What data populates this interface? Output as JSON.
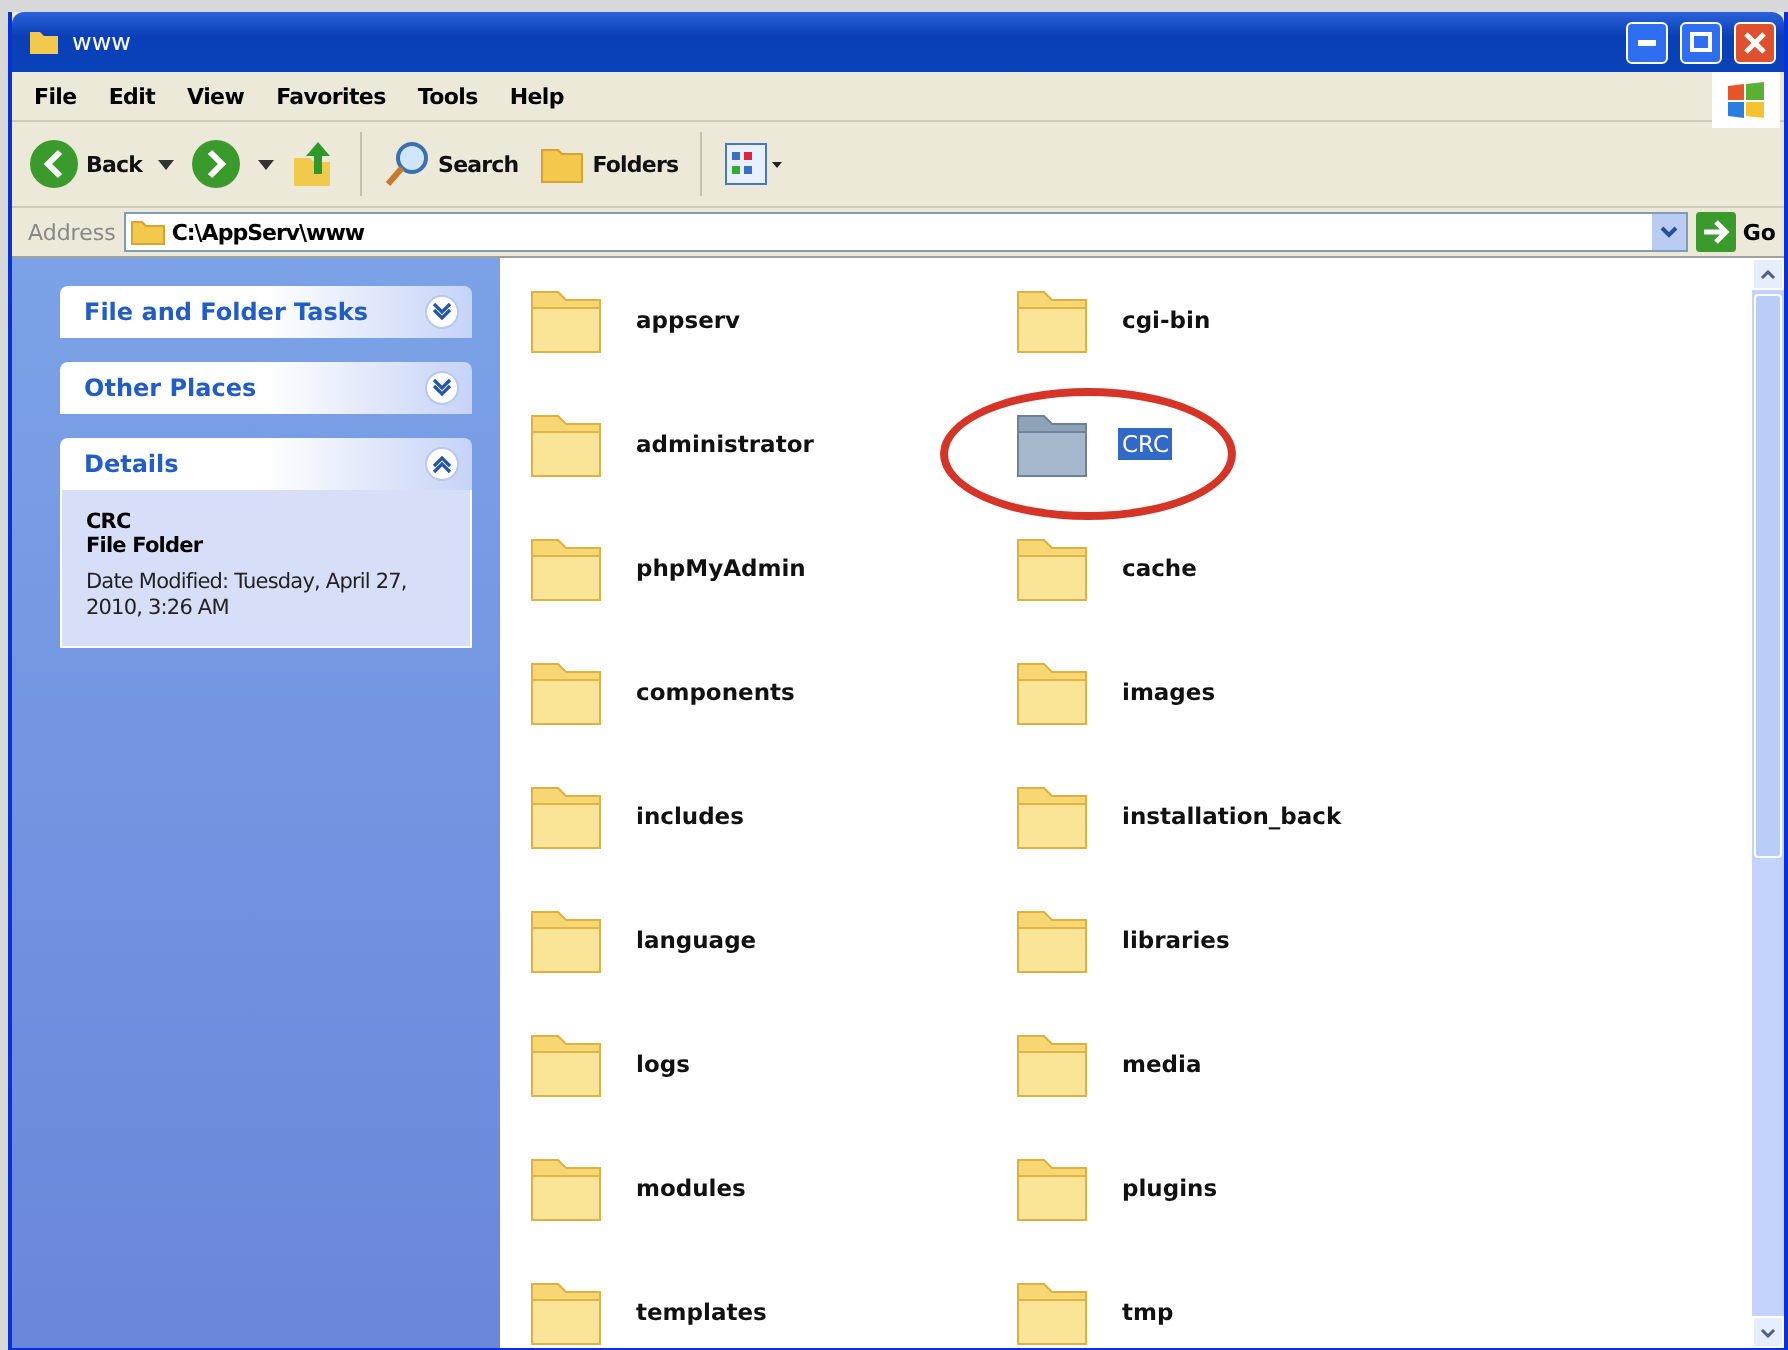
{
  "window": {
    "title": "www"
  },
  "menu": [
    "File",
    "Edit",
    "View",
    "Favorites",
    "Tools",
    "Help"
  ],
  "toolbar": [
    {
      "kind": "back",
      "label": "Back"
    },
    {
      "kind": "forward"
    },
    {
      "kind": "up"
    },
    {
      "kind": "search",
      "label": "Search"
    },
    {
      "kind": "folders",
      "label": "Folders"
    },
    {
      "kind": "views"
    }
  ],
  "address": {
    "label": "Address",
    "value": "C:\\AppServ\\www",
    "go": "Go"
  },
  "sidebar": {
    "panels": [
      {
        "title": "File and Folder Tasks",
        "expanded": false
      },
      {
        "title": "Other Places",
        "expanded": false
      },
      {
        "title": "Details",
        "expanded": true,
        "name": "CRC",
        "type": "File Folder",
        "modified": "Date Modified: Tuesday, April 27, 2010, 3:26 AM"
      }
    ]
  },
  "files": [
    {
      "name": "appserv",
      "selected": false
    },
    {
      "name": "cgi-bin",
      "selected": false
    },
    {
      "name": "administrator",
      "selected": false
    },
    {
      "name": "CRC",
      "selected": true
    },
    {
      "name": "phpMyAdmin",
      "selected": false
    },
    {
      "name": "cache",
      "selected": false
    },
    {
      "name": "components",
      "selected": false
    },
    {
      "name": "images",
      "selected": false
    },
    {
      "name": "includes",
      "selected": false
    },
    {
      "name": "installation_back",
      "selected": false
    },
    {
      "name": "language",
      "selected": false
    },
    {
      "name": "libraries",
      "selected": false
    },
    {
      "name": "logs",
      "selected": false
    },
    {
      "name": "media",
      "selected": false
    },
    {
      "name": "modules",
      "selected": false
    },
    {
      "name": "plugins",
      "selected": false
    },
    {
      "name": "templates",
      "selected": false
    },
    {
      "name": "tmp",
      "selected": false
    }
  ]
}
